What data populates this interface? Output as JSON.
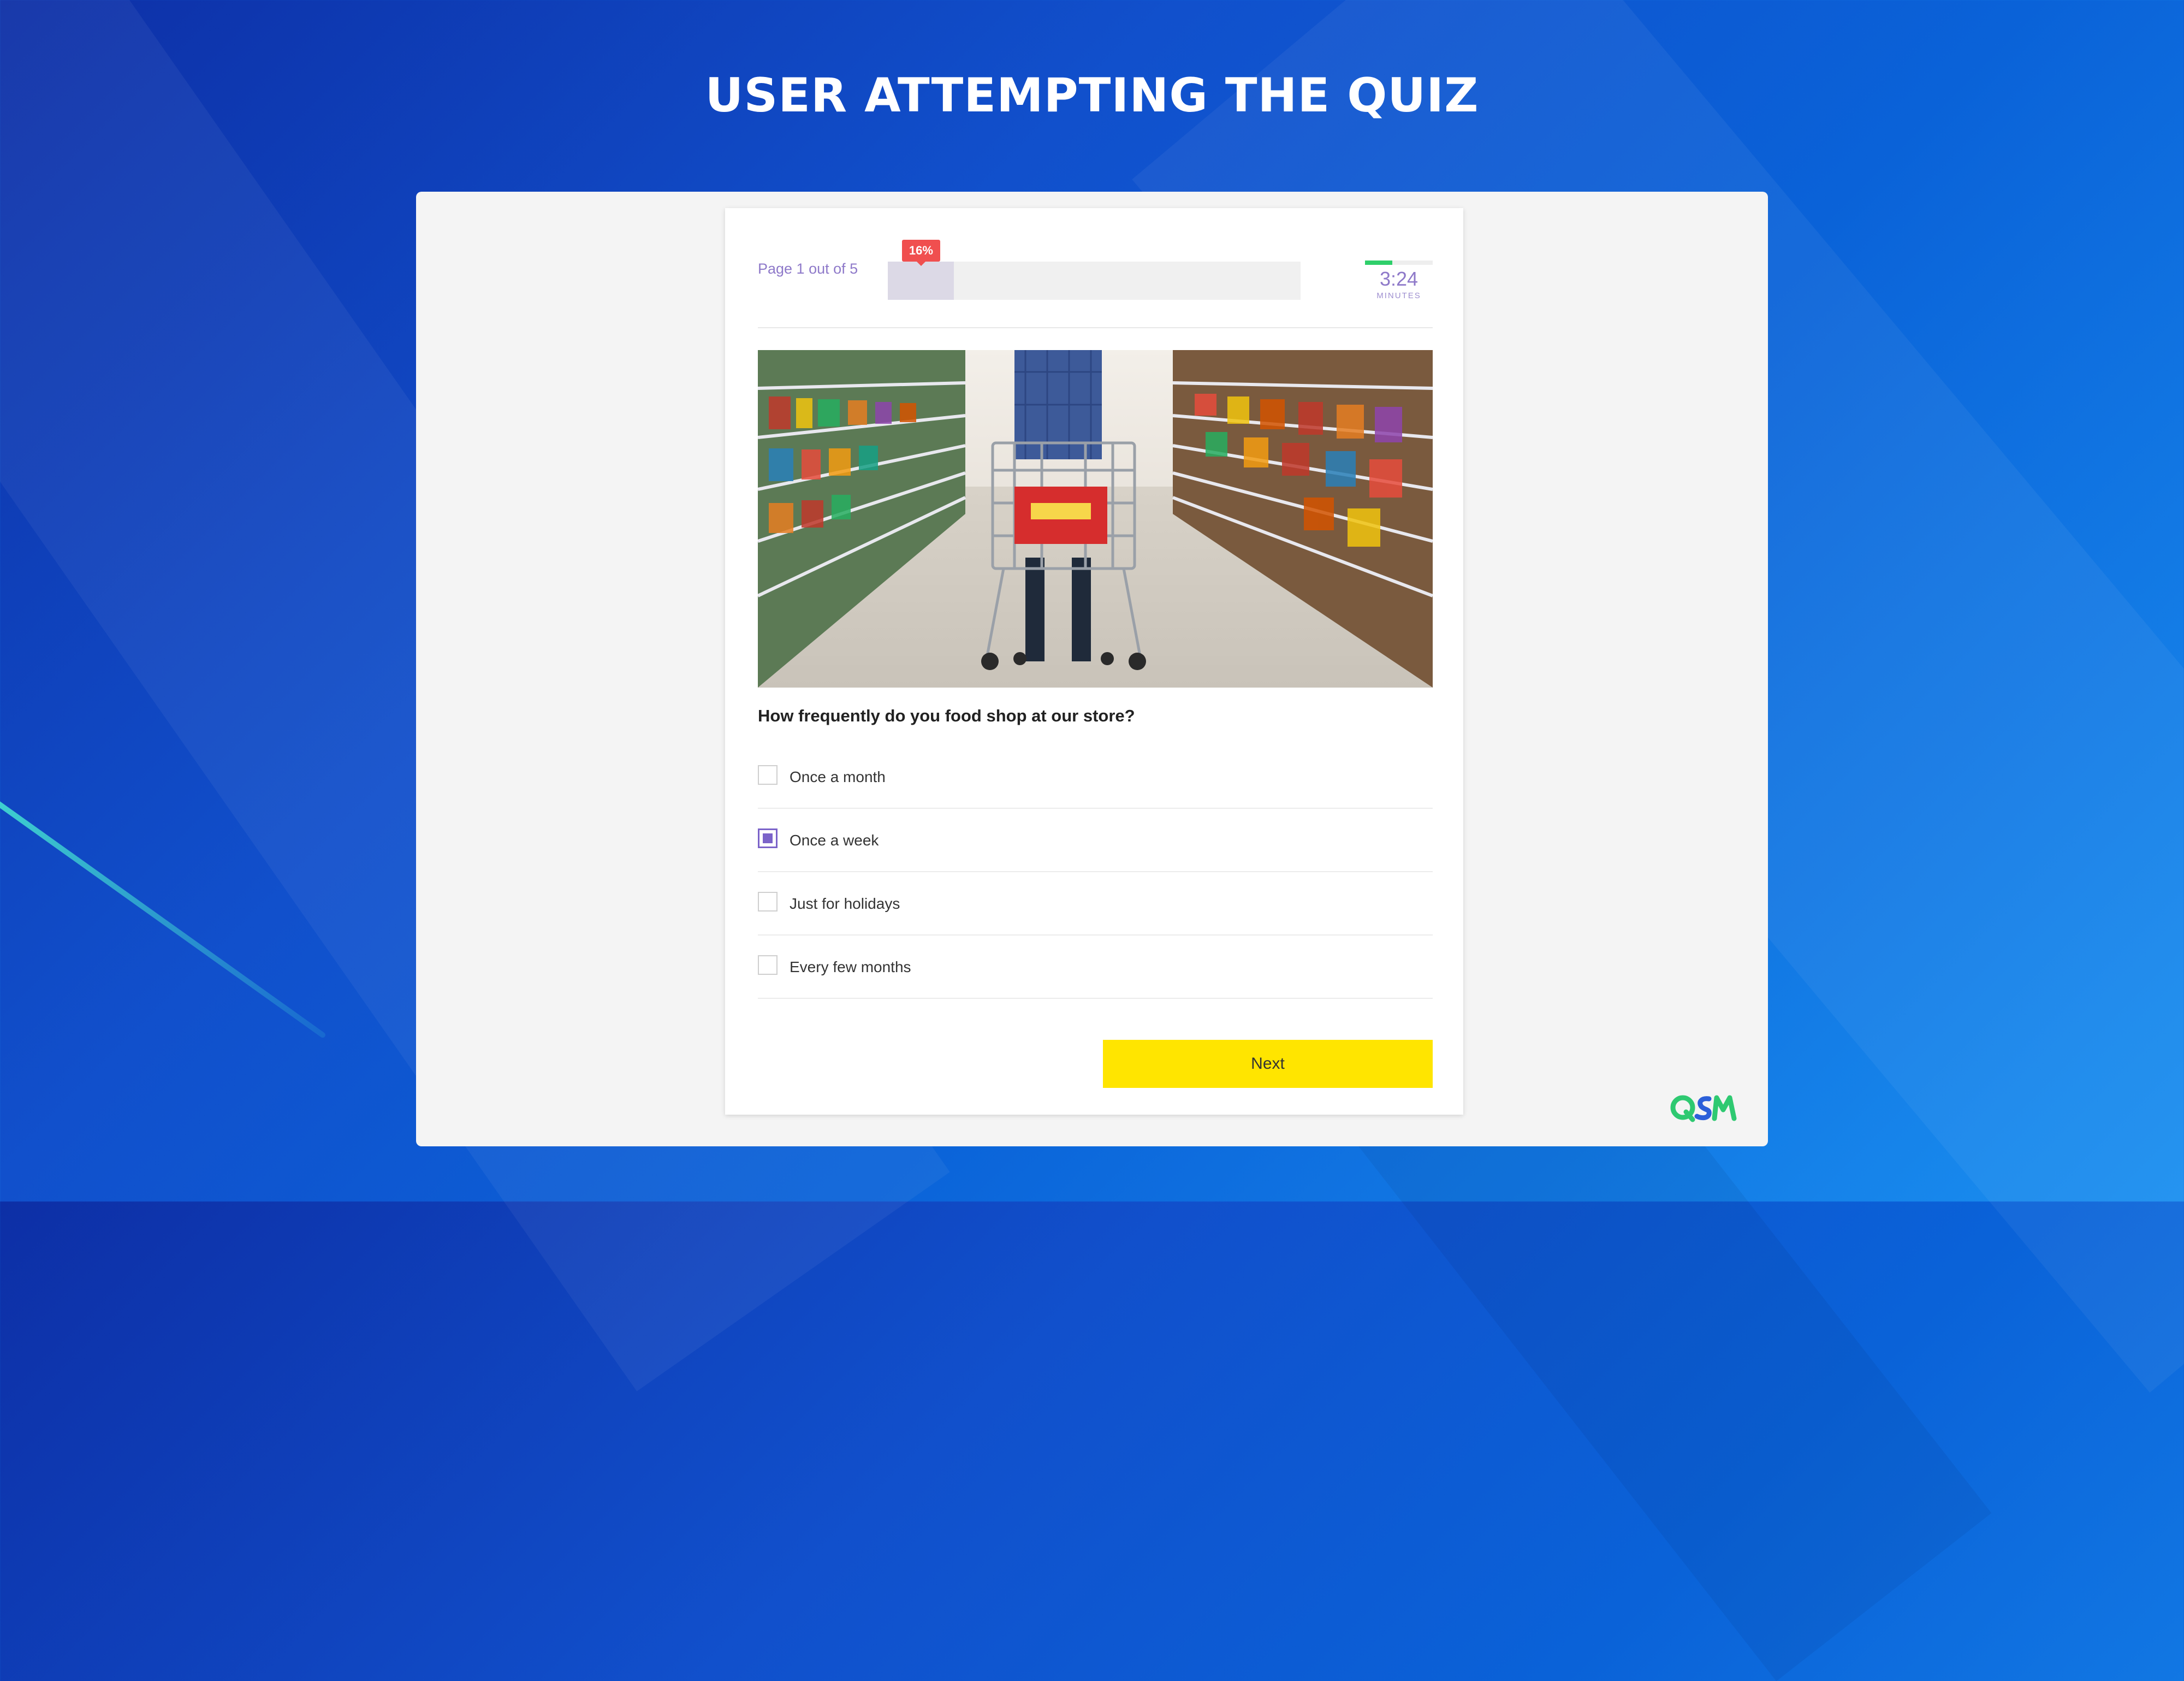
{
  "page": {
    "title": "USER ATTEMPTING THE QUIZ"
  },
  "quiz": {
    "page_indicator": "Page 1 out of 5",
    "progress": {
      "percent_label": "16%",
      "percent": 16
    },
    "timer": {
      "value": "3:24",
      "unit": "MINUTES",
      "remaining_fraction": 0.4
    },
    "image": {
      "description_icon": "shopping-cart-aisle-photo"
    },
    "question": "How frequently do you food shop at our store?",
    "options": [
      {
        "label": "Once a month",
        "checked": false
      },
      {
        "label": "Once a week",
        "checked": true
      },
      {
        "label": "Just for holidays",
        "checked": false
      },
      {
        "label": "Every few months",
        "checked": false
      }
    ],
    "next_button": "Next"
  },
  "colors": {
    "accent_purple": "#7b63c9",
    "progress_badge": "#f04f4f",
    "timer_green": "#2fcf6a",
    "next_button": "#ffe500",
    "logo_green": "#2ec971",
    "logo_blue": "#2b5fd9"
  },
  "logo": {
    "icon": "qsm-logo"
  }
}
